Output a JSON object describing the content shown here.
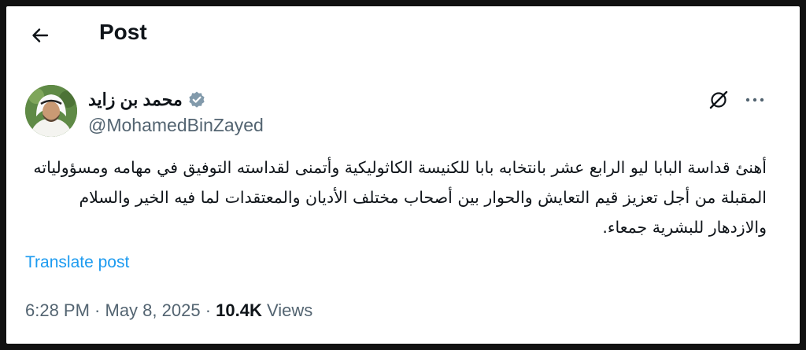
{
  "header": {
    "title": "Post"
  },
  "author": {
    "name": "محمد بن زايد",
    "handle": "@MohamedBinZayed"
  },
  "post": {
    "text": "أهنئ قداسة البابا ليو الرابع عشر بانتخابه بابا للكنيسة الكاثوليكية وأتمنى لقداسته التوفيق في مهامه ومسؤولياته المقبلة من أجل تعزيز قيم التعايش والحوار بين أصحاب مختلف الأديان والمعتقدات لما فيه الخير والسلام والازدهار للبشرية جمعاء.",
    "translate_label": "Translate post",
    "time": "6:28 PM",
    "separator": " · ",
    "date": "May 8, 2025",
    "views_count": "10.4K",
    "views_label": "Views"
  },
  "icons": {
    "back": "arrow-left-icon",
    "verified": "verified-badge-icon",
    "grok": "grok-icon",
    "more": "more-icon"
  },
  "colors": {
    "text": "#0f1419",
    "secondary": "#536471",
    "link": "#1d9bf0",
    "verified": "#829aab"
  }
}
